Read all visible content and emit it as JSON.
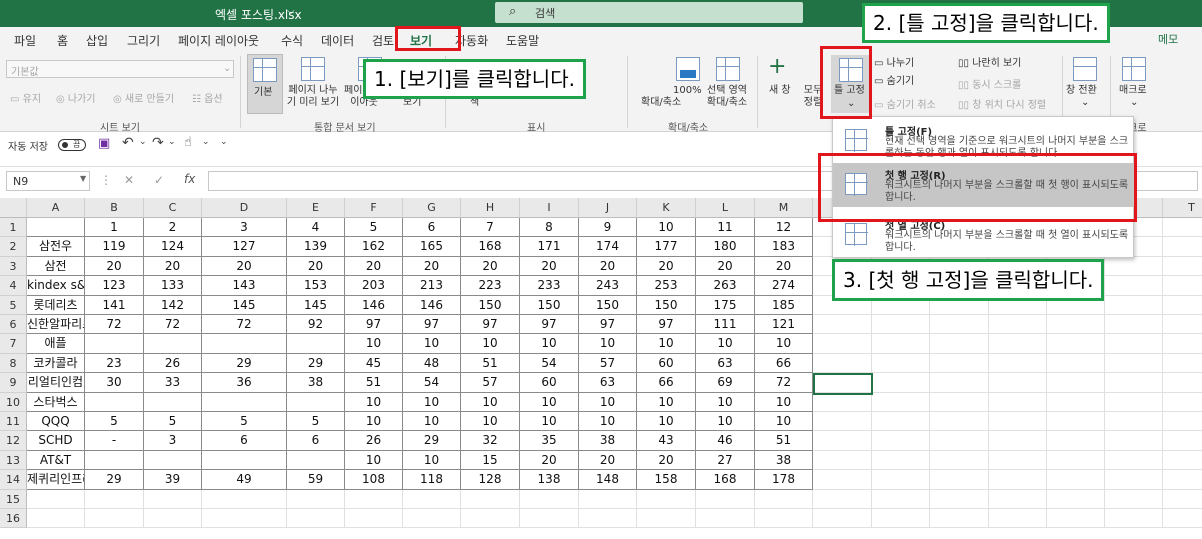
{
  "window": {
    "title": "엑셀 포스팅.xlsx",
    "search_placeholder": "검색"
  },
  "menu": {
    "tabs": [
      "파일",
      "홈",
      "삽입",
      "그리기",
      "페이지 레이아웃",
      "수식",
      "데이터",
      "검토",
      "보기",
      "자동화",
      "도움말"
    ],
    "active": "보기",
    "memo": "메모"
  },
  "ribbon": {
    "sheetview": {
      "default_select": "기본값",
      "keep": "유지",
      "exit": "나가기",
      "new": "새로 만들기",
      "options": "옵션",
      "group": "시트 보기"
    },
    "workbook": {
      "normal": "기본",
      "pagebreak": "페이지 나누기 미리 보기",
      "pagelayout": "페이지 레이아웃",
      "custom": "보기",
      "group": "통합 문서 보기"
    },
    "show": {
      "show_btn": "색",
      "group": "표시"
    },
    "zoom": {
      "zoom": "확대/축소",
      "zoom100": "100%",
      "zoomsel": "선택 영역 확대/축소",
      "group": "확대/축소"
    },
    "window": {
      "newwin": "새 창",
      "arrange": "모두 정렬",
      "freeze": "틀 고정",
      "split": "나누기",
      "hide": "숨기기",
      "unhide": "숨기기 취소",
      "side": "나란히 보기",
      "sync": "동시 스크롤",
      "reset": "창 위치 다시 정렬",
      "switch": "창 전환",
      "macro": "매크로",
      "macro_group": "매크로"
    }
  },
  "qat": {
    "autosave": "자동 저장",
    "toggle": "끔"
  },
  "formula": {
    "namebox": "N9",
    "fx": "fx"
  },
  "columns": [
    "A",
    "B",
    "C",
    "D",
    "E",
    "F",
    "G",
    "H",
    "I",
    "J",
    "K",
    "L",
    "M",
    "N",
    "O",
    "P",
    "Q",
    "R",
    "S",
    "T"
  ],
  "rows": [
    [
      "",
      "1",
      "2",
      "3",
      "4",
      "5",
      "6",
      "7",
      "8",
      "9",
      "10",
      "11",
      "12"
    ],
    [
      "삼전우",
      "119",
      "124",
      "127",
      "139",
      "162",
      "165",
      "168",
      "171",
      "174",
      "177",
      "180",
      "183"
    ],
    [
      "삼전",
      "20",
      "20",
      "20",
      "20",
      "20",
      "20",
      "20",
      "20",
      "20",
      "20",
      "20",
      "20"
    ],
    [
      "kindex s&p",
      "123",
      "133",
      "143",
      "153",
      "203",
      "213",
      "223",
      "233",
      "243",
      "253",
      "263",
      "274"
    ],
    [
      "롯데리츠",
      "141",
      "142",
      "145",
      "145",
      "146",
      "146",
      "150",
      "150",
      "150",
      "150",
      "175",
      "185"
    ],
    [
      "신한알파리츠",
      "72",
      "72",
      "72",
      "92",
      "97",
      "97",
      "97",
      "97",
      "97",
      "97",
      "111",
      "121"
    ],
    [
      "애플",
      "",
      "",
      "",
      "",
      "10",
      "10",
      "10",
      "10",
      "10",
      "10",
      "10",
      "10"
    ],
    [
      "코카콜라",
      "23",
      "26",
      "29",
      "29",
      "45",
      "48",
      "51",
      "54",
      "57",
      "60",
      "63",
      "66"
    ],
    [
      "리얼티인컴",
      "30",
      "33",
      "36",
      "38",
      "51",
      "54",
      "57",
      "60",
      "63",
      "66",
      "69",
      "72"
    ],
    [
      "스타벅스",
      "",
      "",
      "",
      "",
      "10",
      "10",
      "10",
      "10",
      "10",
      "10",
      "10",
      "10"
    ],
    [
      "QQQ",
      "5",
      "5",
      "5",
      "5",
      "10",
      "10",
      "10",
      "10",
      "10",
      "10",
      "10",
      "10"
    ],
    [
      "SCHD",
      "-",
      "3",
      "6",
      "6",
      "26",
      "29",
      "32",
      "35",
      "38",
      "43",
      "46",
      "51"
    ],
    [
      "AT&T",
      "",
      "",
      "",
      "",
      "10",
      "10",
      "15",
      "20",
      "20",
      "20",
      "27",
      "38"
    ],
    [
      "제퀴리인프라",
      "29",
      "39",
      "49",
      "59",
      "108",
      "118",
      "128",
      "138",
      "148",
      "158",
      "168",
      "178"
    ],
    [
      "",
      "",
      "",
      "",
      "",
      "",
      "",
      "",
      "",
      "",
      "",
      "",
      ""
    ],
    [
      "",
      "",
      "",
      "",
      "",
      "",
      "",
      "",
      "",
      "",
      "",
      "",
      ""
    ]
  ],
  "dropdown": [
    {
      "title": "틀 고정(F)",
      "desc": "현재 선택 영역을 기준으로 워크시트의 나머지 부분을 스크롤하는 동안 행과 열이 표시되도록 합니다."
    },
    {
      "title": "첫 행 고정(R)",
      "desc": "워크시트의 나머지 부분을 스크롤할 때 첫 행이 표시되도록 합니다."
    },
    {
      "title": "첫 열 고정(C)",
      "desc": "워크시트의 나머지 부분을 스크롤할 때 첫 열이 표시되도록 합니다."
    }
  ],
  "callouts": {
    "step1": "1. [보기]를 클릭합니다.",
    "step2": "2. [틀 고정]을 클릭합니다.",
    "step3": "3. [첫 행 고정]을 클릭합니다."
  },
  "colors": {
    "accent": "#217346",
    "callout_border": "#1fa34a",
    "highlight_border": "#e0161c"
  }
}
